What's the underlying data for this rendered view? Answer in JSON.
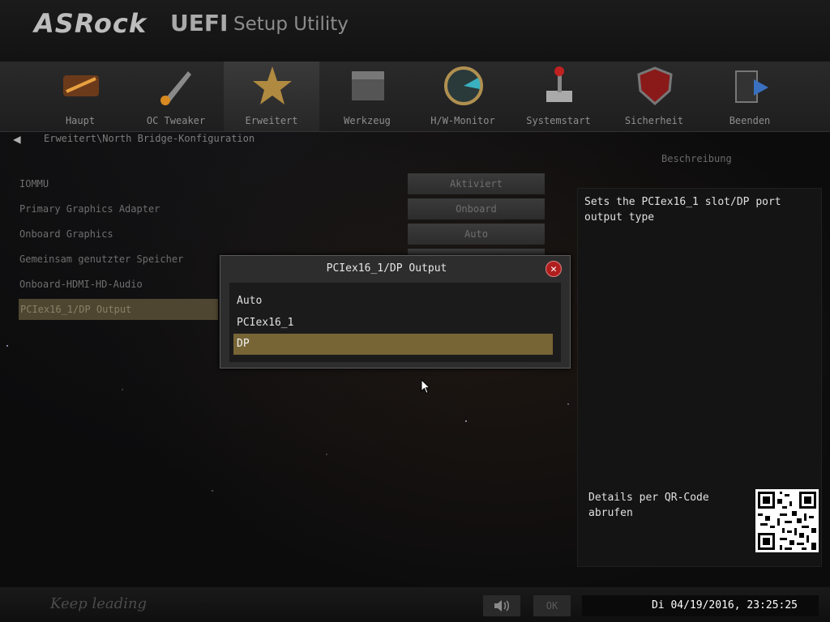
{
  "header": {
    "brand": "ASRock",
    "product": "UEFI",
    "subtitle": "Setup Utility"
  },
  "nav": {
    "tabs": [
      {
        "label": "Haupt",
        "icon": "main-icon"
      },
      {
        "label": "OC Tweaker",
        "icon": "rocket-icon"
      },
      {
        "label": "Erweitert",
        "icon": "star-icon",
        "active": true
      },
      {
        "label": "Werkzeug",
        "icon": "toolbox-icon"
      },
      {
        "label": "H/W-Monitor",
        "icon": "radar-icon"
      },
      {
        "label": "Systemstart",
        "icon": "joystick-icon"
      },
      {
        "label": "Sicherheit",
        "icon": "shield-icon"
      },
      {
        "label": "Beenden",
        "icon": "exit-door-icon"
      }
    ]
  },
  "breadcrumb": "Erweitert\\North Bridge-Konfiguration",
  "settings": [
    {
      "label": "IOMMU",
      "value": "Aktiviert"
    },
    {
      "label": "Primary Graphics Adapter",
      "value": "Onboard"
    },
    {
      "label": "Onboard Graphics",
      "value": "Auto"
    },
    {
      "label": "Gemeinsam genutzter Speicher",
      "value": ""
    },
    {
      "label": "Onboard-HDMI-HD-Audio",
      "value": ""
    },
    {
      "label": "PCIex16_1/DP Output",
      "value": ""
    }
  ],
  "description": {
    "title": "Beschreibung",
    "text": "Sets the PCIex16_1 slot/DP port output type",
    "qr_text": "Details per QR-Code abrufen"
  },
  "dialog": {
    "title": "PCIex16_1/DP Output",
    "options": [
      "Auto",
      "PCIex16_1",
      "DP"
    ],
    "selected": "DP"
  },
  "footer": {
    "slogan": "Keep leading",
    "ok_label": "OK",
    "datetime": "Di 04/19/2016, 23:25:25"
  },
  "colors": {
    "selection": "#776536",
    "close_button": "#b01e1e"
  }
}
